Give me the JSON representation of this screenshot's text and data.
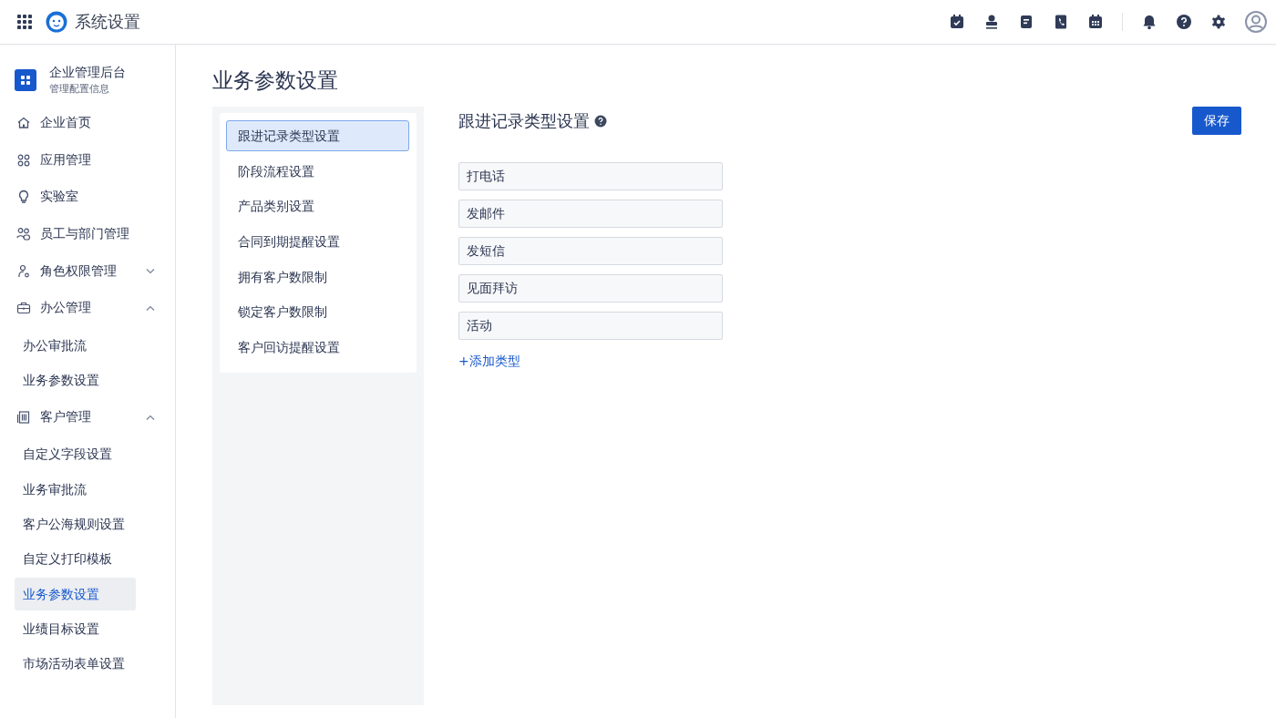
{
  "header": {
    "title": "系统设置"
  },
  "sidebar": {
    "org": {
      "name": "企业管理后台",
      "subtitle": "管理配置信息"
    },
    "items": [
      {
        "label": "企业首页"
      },
      {
        "label": "应用管理"
      },
      {
        "label": "实验室"
      },
      {
        "label": "员工与部门管理"
      },
      {
        "label": "角色权限管理",
        "expanded": false
      },
      {
        "label": "办公管理",
        "expanded": true,
        "children": [
          {
            "label": "办公审批流",
            "selected": false
          },
          {
            "label": "业务参数设置",
            "selected": false
          }
        ]
      },
      {
        "label": "客户管理",
        "expanded": true,
        "children": [
          {
            "label": "自定义字段设置",
            "selected": false
          },
          {
            "label": "业务审批流",
            "selected": false
          },
          {
            "label": "客户公海规则设置",
            "selected": false
          },
          {
            "label": "自定义打印模板",
            "selected": false
          },
          {
            "label": "业务参数设置",
            "selected": true
          },
          {
            "label": "业绩目标设置",
            "selected": false
          },
          {
            "label": "市场活动表单设置",
            "selected": false
          }
        ]
      }
    ]
  },
  "page": {
    "title": "业务参数设置"
  },
  "settings_menu": [
    {
      "label": "跟进记录类型设置",
      "selected": true
    },
    {
      "label": "阶段流程设置",
      "selected": false
    },
    {
      "label": "产品类别设置",
      "selected": false
    },
    {
      "label": "合同到期提醒设置",
      "selected": false
    },
    {
      "label": "拥有客户数限制",
      "selected": false
    },
    {
      "label": "锁定客户数限制",
      "selected": false
    },
    {
      "label": "客户回访提醒设置",
      "selected": false
    }
  ],
  "section": {
    "title": "跟进记录类型设置",
    "save_button": "保存",
    "types": [
      "打电话",
      "发邮件",
      "发短信",
      "见面拜访",
      "活动"
    ],
    "add_link": "+添加类型"
  }
}
